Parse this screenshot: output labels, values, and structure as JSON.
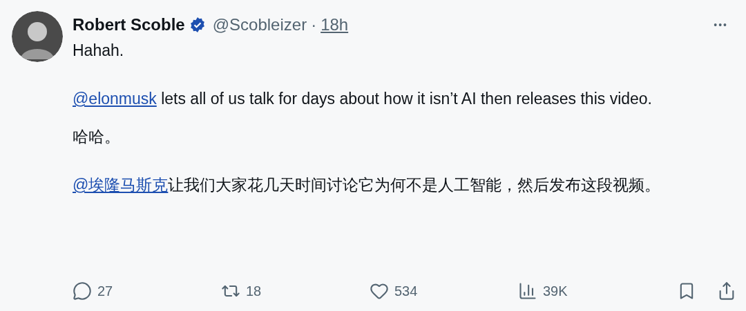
{
  "author": {
    "name": "Robert Scoble",
    "verified": true,
    "handle": "@Scobleizer",
    "separator": "·",
    "time": "18h"
  },
  "more": "•••",
  "sections": [
    {
      "paragraphs": [
        {
          "text": "Hahah."
        },
        {
          "mention": "@elonmusk",
          "text": " lets all of us talk for days about how it isn’t AI then releases this video."
        }
      ]
    },
    {
      "paragraphs": [
        {
          "text": "哈哈。"
        },
        {
          "mention": "@埃隆马斯克",
          "text": "让我们大家花几天时间讨论它为何不是人工智能，然后发布这段视频。"
        }
      ]
    }
  ],
  "actions": [
    {
      "kind": "reply",
      "count": "27"
    },
    {
      "kind": "repost",
      "count": "18"
    },
    {
      "kind": "like",
      "count": "534"
    },
    {
      "kind": "views",
      "count": "39K"
    },
    {
      "kind": "bookmark"
    },
    {
      "kind": "share"
    }
  ]
}
